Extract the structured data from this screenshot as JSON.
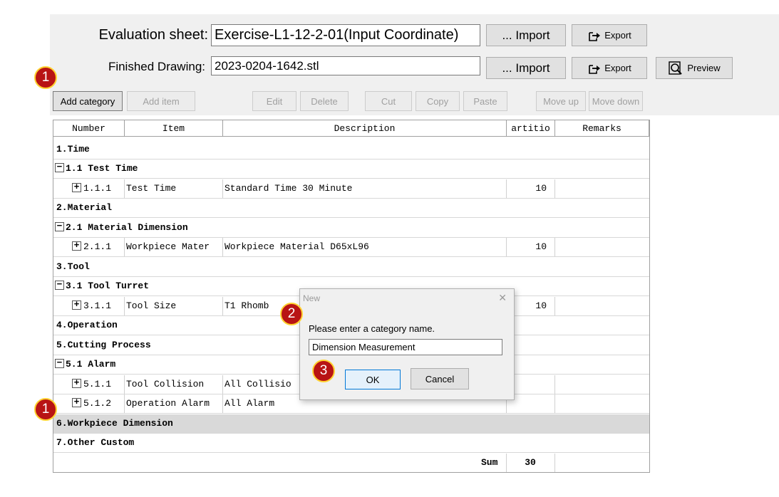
{
  "header": {
    "eval_label": "Evaluation sheet:",
    "eval_value": "Exercise-L1-12-2-01(Input Coordinate)",
    "drawing_label": "Finished Drawing:",
    "drawing_value": "2023-0204-1642.stl",
    "import_label": "... Import",
    "export_label": "Export",
    "preview_label": "Preview"
  },
  "toolbar": {
    "add_category": "Add category",
    "add_item": "Add item",
    "edit": "Edit",
    "delete": "Delete",
    "cut": "Cut",
    "copy": "Copy",
    "paste": "Paste",
    "move_up": "Move up",
    "move_down": "Move down"
  },
  "table": {
    "columns": [
      "Number",
      "Item",
      "Description",
      "artitio",
      "Remarks"
    ],
    "rows": [
      {
        "number": "1.Time"
      },
      {
        "number": "1.1 Test Time"
      },
      {
        "number": "1.1.1",
        "item": "Test Time",
        "description": "Standard Time 30 Minute",
        "value": "10"
      },
      {
        "number": "2.Material"
      },
      {
        "number": "2.1 Material Dimension"
      },
      {
        "number": "2.1.1",
        "item": "Workpiece Mater",
        "description": "Workpiece Material D65xL96",
        "value": "10"
      },
      {
        "number": "3.Tool"
      },
      {
        "number": "3.1 Tool Turret"
      },
      {
        "number": "3.1.1",
        "item": "Tool Size",
        "description": "T1  Rhomb",
        "value": "10"
      },
      {
        "number": "4.Operation"
      },
      {
        "number": "5.Cutting Process"
      },
      {
        "number": "5.1 Alarm"
      },
      {
        "number": "5.1.1",
        "item": "Tool Collision",
        "description": "All Collisio"
      },
      {
        "number": "5.1.2",
        "item": "Operation Alarm",
        "description": "All Alarm"
      },
      {
        "number": "6.Workpiece Dimension"
      },
      {
        "number": "7.Other Custom"
      }
    ],
    "sum_label": "Sum",
    "sum_value": "30"
  },
  "dialog": {
    "title": "New",
    "close": "✕",
    "prompt": "Please enter a category name.",
    "input_value": "Dimension Measurement",
    "ok": "OK",
    "cancel": "Cancel"
  },
  "badges": {
    "one": "1",
    "two": "2",
    "three": "3"
  },
  "colors": {
    "badge": "#b81414",
    "badge_border": "#ffd230",
    "highlight_row": "#d9d9d9"
  }
}
